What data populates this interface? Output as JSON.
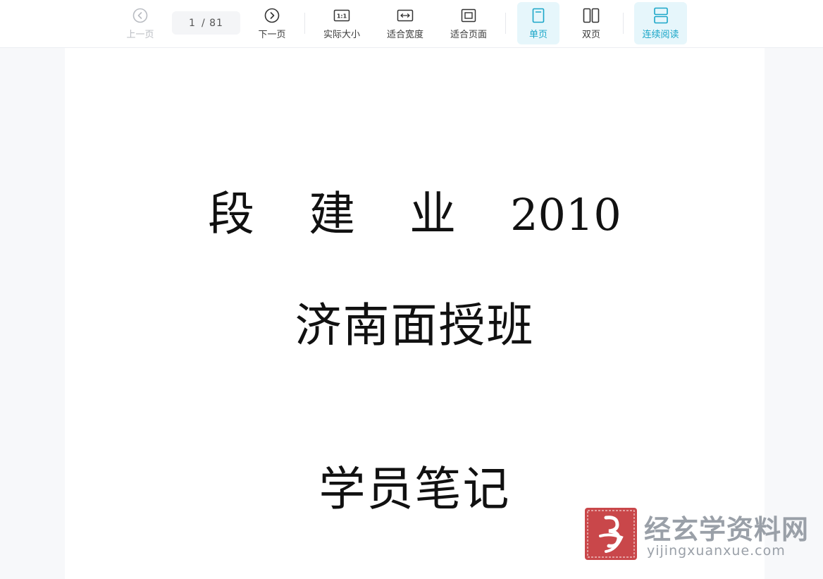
{
  "toolbar": {
    "prev_label": "上一页",
    "next_label": "下一页",
    "page_current": "1",
    "page_total": "/ 81",
    "actual_size_label": "实际大小",
    "fit_width_label": "适合宽度",
    "fit_page_label": "适合页面",
    "single_page_label": "单页",
    "double_page_label": "双页",
    "continuous_label": "连续阅读",
    "actual_size_icon_text": "1:1"
  },
  "document": {
    "line1_chars": "段 建 业",
    "line1_year": "2010",
    "line2": "济南面授班",
    "line3": "学员笔记"
  },
  "watermark": {
    "site_name": "经玄学资料网",
    "site_url": "yijingxuanxue.com"
  },
  "colors": {
    "accent": "#1aa6c8",
    "active_bg": "#e6f6fb",
    "seal_red": "#c9474a",
    "watermark_gray": "#9aa0a8"
  },
  "icons": {
    "prev": "chevron-left-circle-icon",
    "next": "chevron-right-circle-icon",
    "actual_size": "actual-size-icon",
    "fit_width": "fit-width-icon",
    "fit_page": "fit-page-icon",
    "single_page": "single-page-icon",
    "double_page": "double-page-icon",
    "continuous": "continuous-read-icon"
  }
}
